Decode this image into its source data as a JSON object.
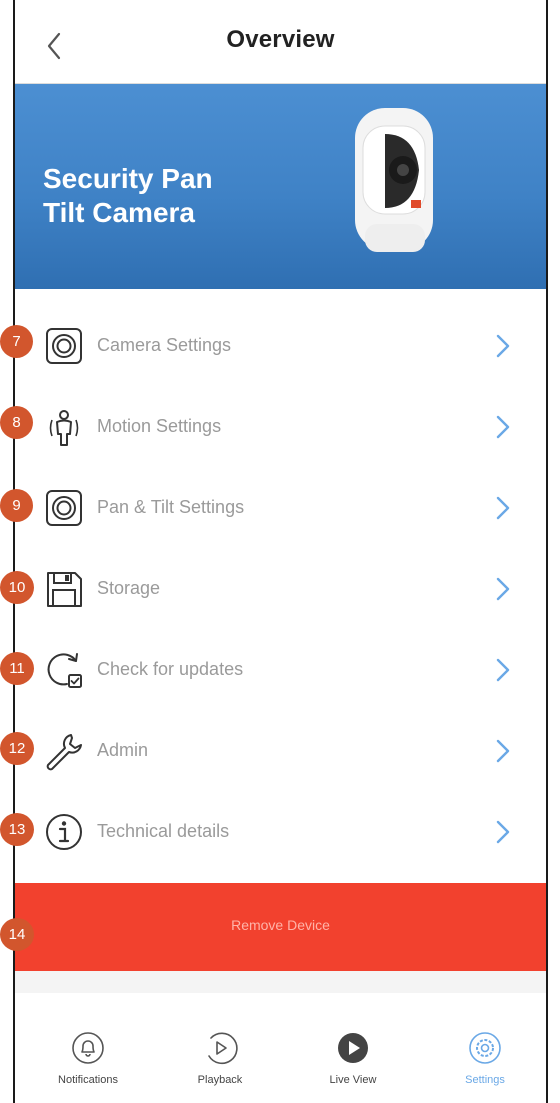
{
  "header": {
    "title": "Overview"
  },
  "hero": {
    "title_line1": "Security Pan",
    "title_line2": "Tilt Camera"
  },
  "menu": {
    "items": [
      {
        "label": "Camera Settings",
        "icon": "camera-lens-icon",
        "badge": "7"
      },
      {
        "label": "Motion Settings",
        "icon": "motion-person-icon",
        "badge": "8"
      },
      {
        "label": "Pan & Tilt Settings",
        "icon": "camera-lens-icon",
        "badge": "9"
      },
      {
        "label": "Storage",
        "icon": "floppy-disk-icon",
        "badge": "10"
      },
      {
        "label": "Check for updates",
        "icon": "update-refresh-icon",
        "badge": "11"
      },
      {
        "label": "Admin",
        "icon": "wrench-icon",
        "badge": "12"
      },
      {
        "label": "Technical details",
        "icon": "info-icon",
        "badge": "13"
      }
    ]
  },
  "remove": {
    "label": "Remove Device",
    "badge": "14"
  },
  "tabs": [
    {
      "label": "Notifications",
      "icon": "bell-icon"
    },
    {
      "label": "Playback",
      "icon": "playback-icon"
    },
    {
      "label": "Live View",
      "icon": "play-circle-icon"
    },
    {
      "label": "Settings",
      "icon": "settings-gear-icon",
      "active": true
    }
  ],
  "colors": {
    "accent": "#3f82c6",
    "danger": "#f2412e",
    "badge": "#d2562d",
    "active_tab": "#6aa8e6"
  }
}
